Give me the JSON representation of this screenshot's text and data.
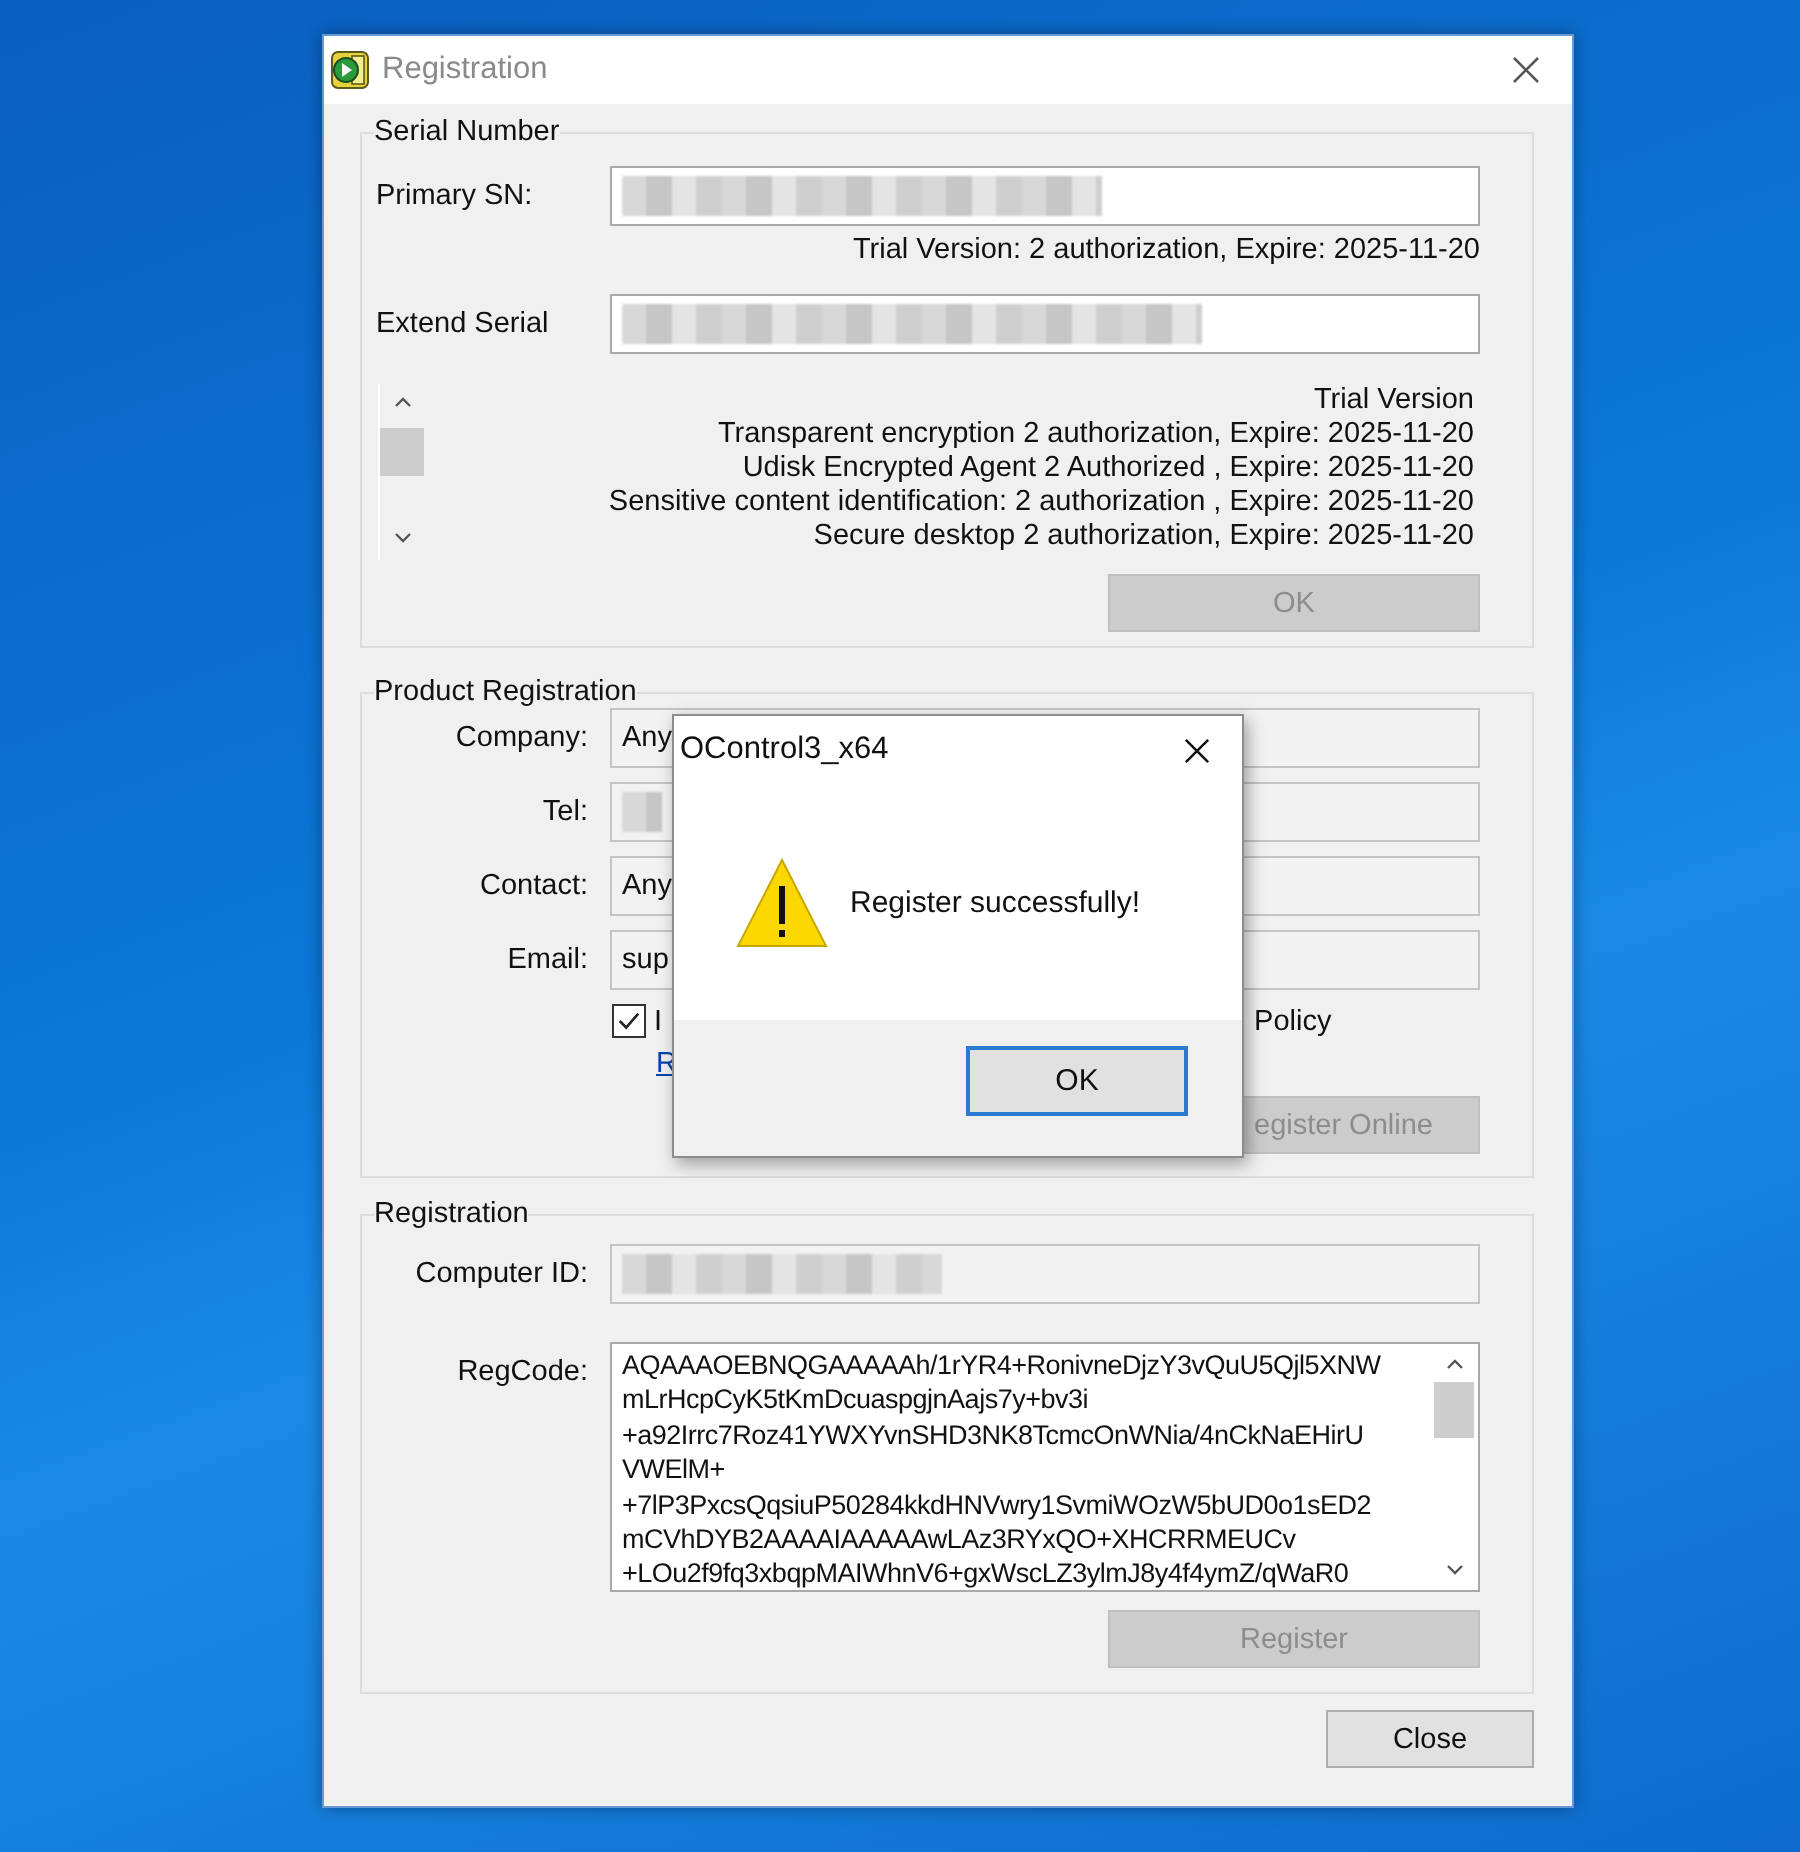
{
  "window": {
    "title": "Registration"
  },
  "serial_number": {
    "title": "Serial Number",
    "primary_sn": {
      "label": "Primary SN:"
    },
    "trial_info": "Trial Version: 2 authorization, Expire: 2025-11-20",
    "extend_serial": {
      "label": "Extend Serial"
    },
    "license_lines": [
      "Trial Version",
      "Transparent encryption 2 authorization, Expire: 2025-11-20",
      "Udisk Encrypted Agent 2 Authorized , Expire: 2025-11-20",
      "Sensitive content identification: 2 authorization , Expire: 2025-11-20",
      "Secure desktop  2 authorization, Expire: 2025-11-20"
    ],
    "ok_button": {
      "label": "OK",
      "disabled": true
    }
  },
  "product_registration": {
    "title": "Product Registration",
    "fields": [
      {
        "label": "Company:",
        "kind": "text",
        "value": "Any"
      },
      {
        "label": "Tel:",
        "kind": "redacted"
      },
      {
        "label": "Contact:",
        "kind": "text",
        "value": "Any"
      },
      {
        "label": "Email:",
        "kind": "text",
        "value": "sup"
      }
    ],
    "agreement": {
      "checked": true,
      "label": "I",
      "label_end": "Policy"
    },
    "link": "R",
    "register_online_button": {
      "label": "egister Online",
      "disabled": true
    }
  },
  "registration": {
    "title": "Registration",
    "computer_id": {
      "label": "Computer ID:"
    },
    "regcode": {
      "label": "RegCode:",
      "lines": [
        "AQAAAOEBNQGAAAAAh/1rYR4+RonivneDjzY3vQuU5Qjl5XNW",
        "mLrHcpCyK5tKmDcuaspgjnAajs7y+bv3i",
        "+a92Irrc7Roz41YWXYvnSHD3NK8TcmcOnWNia/4nCkNaEHirU",
        "VWElM+",
        "+7lP3PxcsQqsiuP50284kkdHNVwry1SvmiWOzW5bUD0o1sED2",
        "mCVhDYB2AAAAIAAAAAwLAz3RYxQO+XHCRRMEUCv",
        "+LOu2f9fq3xbqpMAIWhnV6+gxWscLZ3ylmJ8y4f4ymZ/qWaR0"
      ]
    },
    "register_button": {
      "label": "Register",
      "disabled": true
    }
  },
  "close_button": {
    "label": "Close",
    "disabled": false
  },
  "dialog": {
    "title": "OControl3_x64",
    "message": "Register successfully!",
    "ok_button": {
      "label": "OK",
      "disabled": false
    }
  }
}
